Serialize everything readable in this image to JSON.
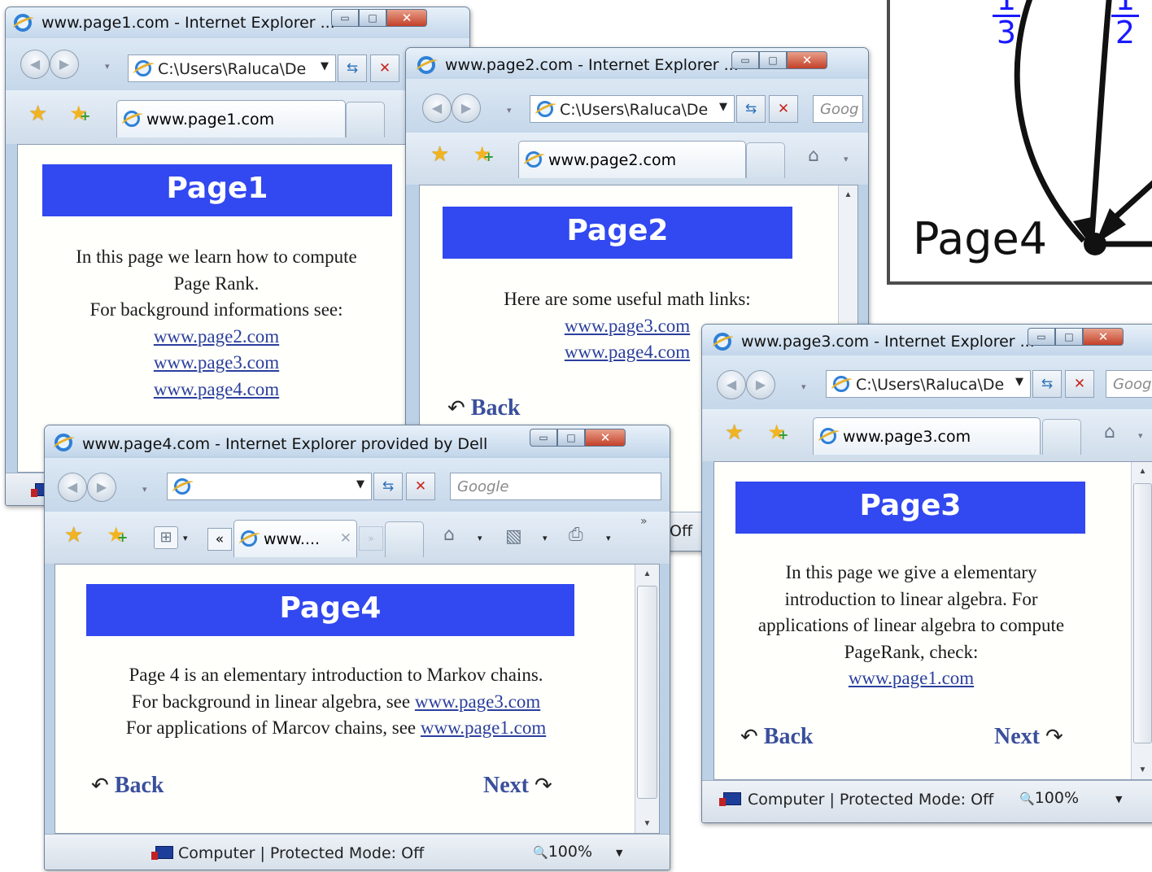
{
  "graph": {
    "node_label": "Page4",
    "fraction_left": {
      "num": "1",
      "den": "3"
    },
    "fraction_right": {
      "num": "1",
      "den": "2"
    }
  },
  "window1": {
    "title": "www.page1.com - Internet Explorer ...",
    "address": "C:\\Users\\Raluca\\De",
    "tab_label": "www.page1.com",
    "heading": "Page1",
    "lines": [
      "In this page we learn how to compute",
      "Page Rank.",
      "For background informations see:"
    ],
    "links": [
      "www.page2.com",
      "www.page3.com",
      "www.page4.com"
    ]
  },
  "window2": {
    "title": "www.page2.com - Internet Explorer ...",
    "address": "C:\\Users\\Raluca\\De",
    "search": "Goog",
    "tab_label": "www.page2.com",
    "heading": "Page2",
    "line": "Here are some useful math links:",
    "links": [
      "www.page3.com",
      "www.page4.com"
    ],
    "back": "Back",
    "status_partial": "Off"
  },
  "window3": {
    "title": "www.page3.com - Internet Explorer ...",
    "address": "C:\\Users\\Raluca\\De",
    "search": "Goog",
    "tab_label": "www.page3.com",
    "heading": "Page3",
    "lines": [
      "In this page we give a elementary",
      "introduction to linear algebra. For",
      "applications of linear algebra to compute",
      "PageRank, check:"
    ],
    "link": "www.page1.com",
    "back": "Back",
    "next": "Next",
    "status": "Computer | Protected Mode: Off",
    "zoom": "100%"
  },
  "window4": {
    "title": "www.page4.com - Internet Explorer provided by Dell",
    "search": "Google",
    "tab_label": "www....",
    "heading": "Page4",
    "line1": "Page 4 is an elementary introduction to Markov chains.",
    "line2_text": "For background in linear algebra, see ",
    "line2_link": "www.page3.com",
    "line3_text": "For applications of Marcov chains, see ",
    "line3_link": "www.page1.com",
    "back": "Back",
    "next": "Next",
    "status": "Computer | Protected Mode: Off",
    "zoom": "100%"
  },
  "icons": {
    "back_glyph": "↶",
    "next_glyph": "↷"
  }
}
